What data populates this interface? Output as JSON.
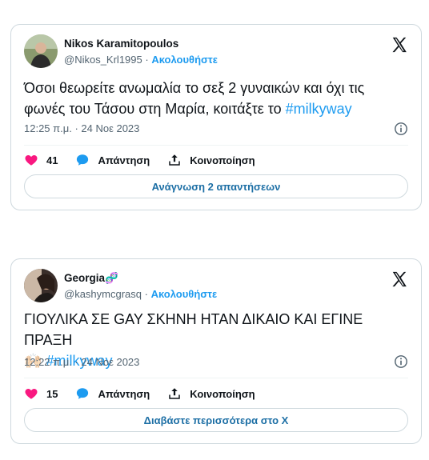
{
  "tweets": [
    {
      "author_name": "Nikos Karamitopoulos",
      "name_suffix": "",
      "handle": "@Nikos_Krl1995",
      "separator": " · ",
      "follow_label": "Ακολουθήστε",
      "text": "Όσοι θεωρείτε ανωμαλία το σεξ 2 γυναικών και όχι τις φωνές του Τάσου στη Μαρία, κοιτάξτε το ",
      "text_emoji": "",
      "hashtag": "#milkyway",
      "timestamp": "12:25 π.μ. · 24 Νοε 2023",
      "likes": "41",
      "reply_label": "Απάντηση",
      "share_label": "Κοινοποίηση",
      "button_label": "Ανάγνωση 2 απαντήσεων",
      "icons": [
        "x-logo-icon",
        "info-icon",
        "heart-icon",
        "reply-bubble-icon",
        "share-upload-icon"
      ]
    },
    {
      "author_name": "Georgia",
      "name_suffix": "🧬",
      "handle": "@kashymcgrasq",
      "separator": " · ",
      "follow_label": "Ακολουθήστε",
      "text": "ΓΙΟΥΛΙΚΑ ΣΕ GAY ΣΚΗΝΗ ΗΤΑΝ ΔΙΚΑΙΟ ΚΑΙ ΕΓΙΝΕ ΠΡΑΞΗ",
      "text_emoji": "🙌🏻",
      "hashtag": "#milkyway",
      "timestamp": "12:22 π.μ. · 24 Νοε 2023",
      "likes": "15",
      "reply_label": "Απάντηση",
      "share_label": "Κοινοποίηση",
      "button_label": "Διαβάστε περισσότερα στο X",
      "icons": [
        "x-logo-icon",
        "info-icon",
        "heart-icon",
        "reply-bubble-icon",
        "share-upload-icon"
      ]
    }
  ],
  "colors": {
    "accent_blue": "#1d9bf0",
    "heart_pink": "#f91880",
    "text_dark": "#0f1419",
    "text_muted": "#536471",
    "border": "#cfd9de"
  }
}
